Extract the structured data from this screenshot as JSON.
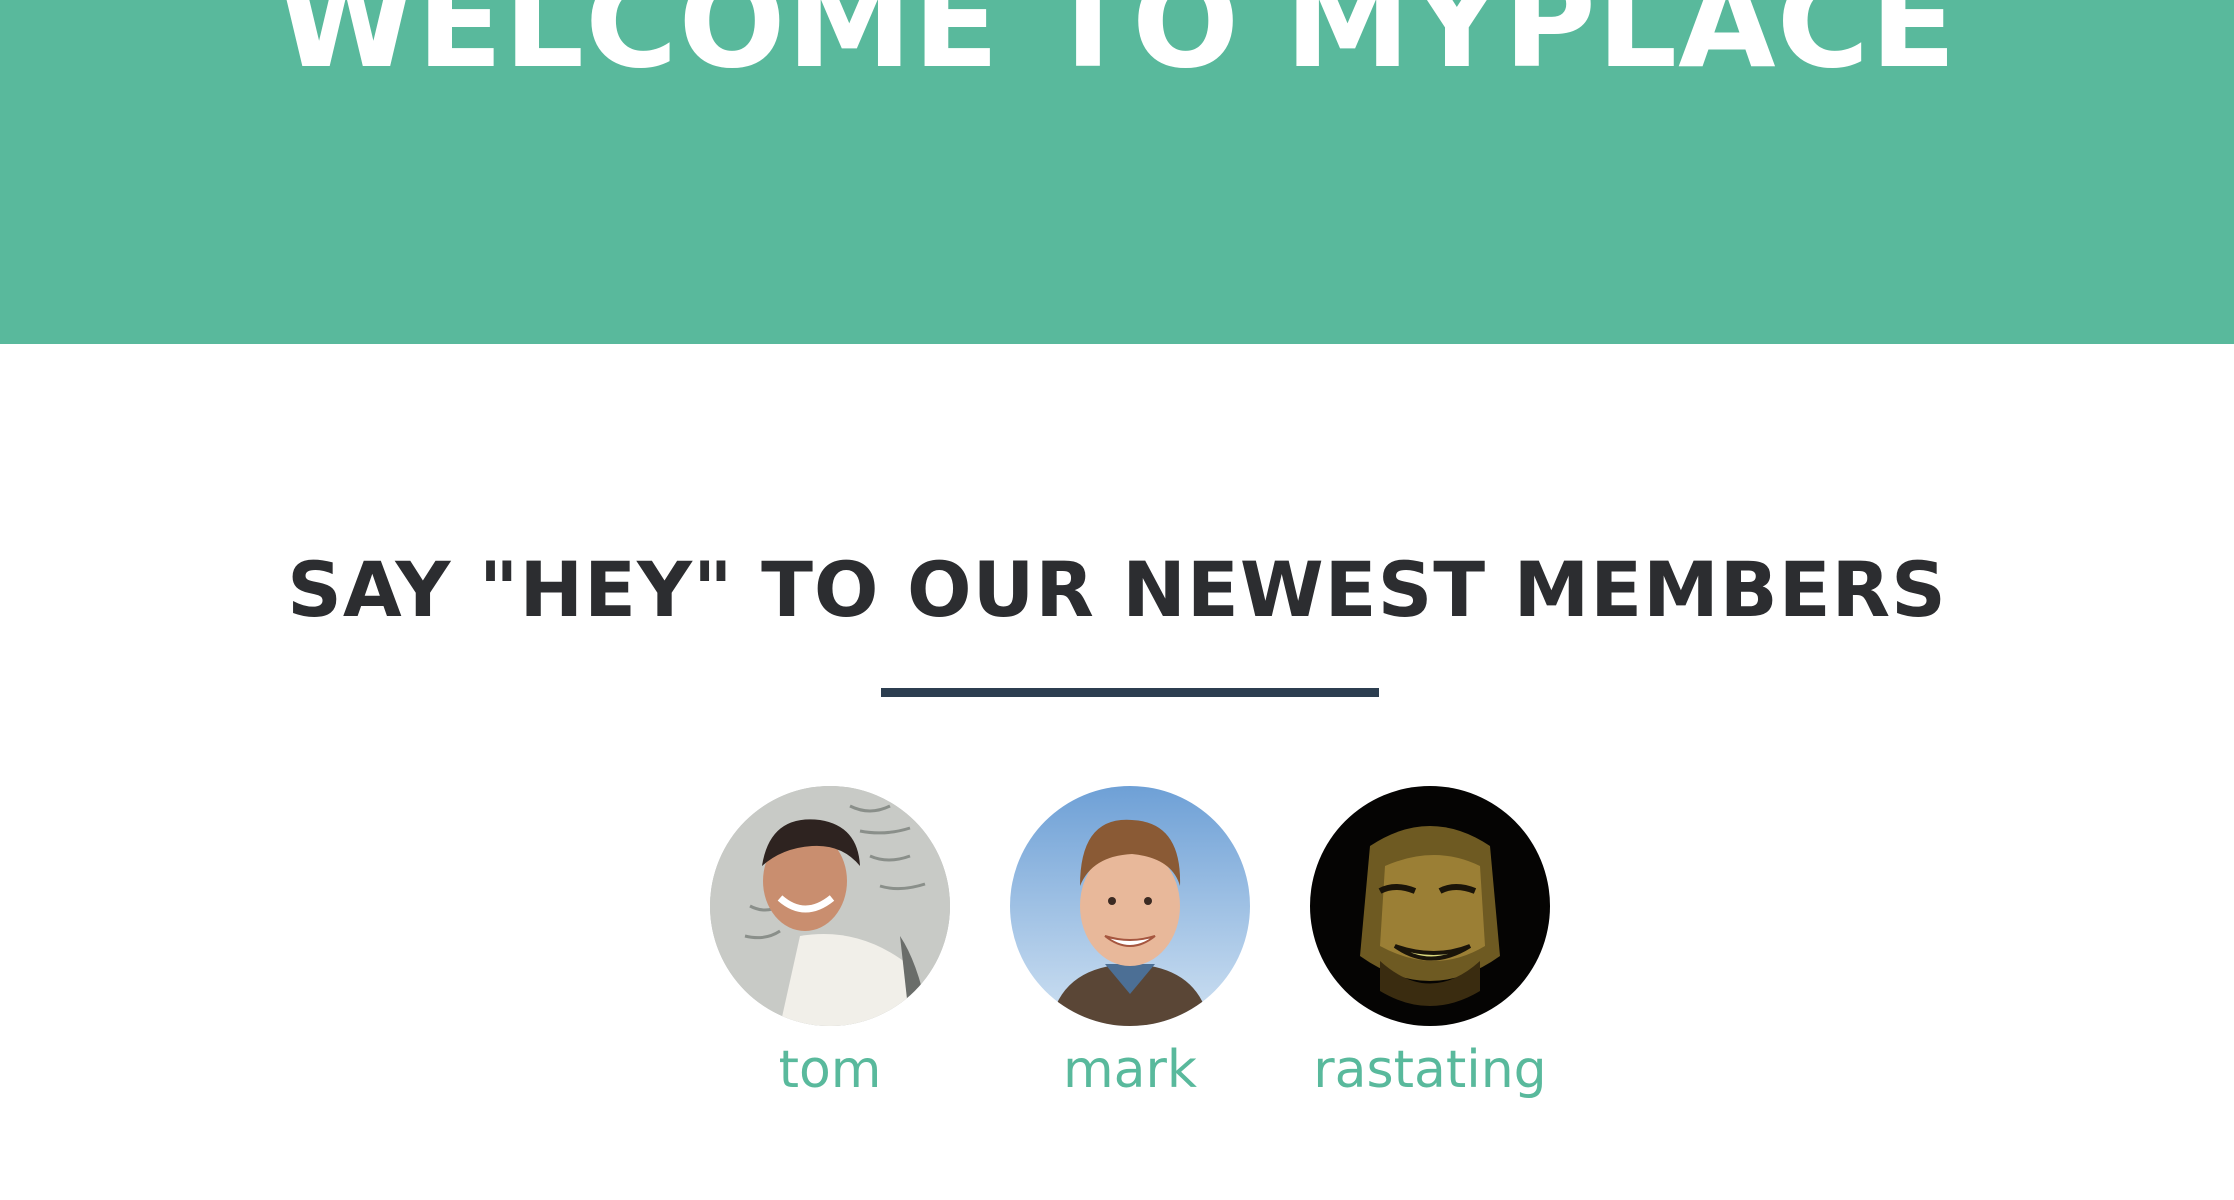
{
  "colors": {
    "hero_background": "#59b99c",
    "heading_text": "#2c2d30",
    "divider": "#2c3e50",
    "member_name": "#59b99c"
  },
  "hero": {
    "title": "WELCOME TO MYPLACE"
  },
  "newest_members": {
    "heading": "SAY \"HEY\" TO OUR NEWEST MEMBERS",
    "members": [
      {
        "name": "tom",
        "avatar": "profile-photo"
      },
      {
        "name": "mark",
        "avatar": "profile-photo"
      },
      {
        "name": "rastating",
        "avatar": "profile-photo"
      }
    ]
  }
}
